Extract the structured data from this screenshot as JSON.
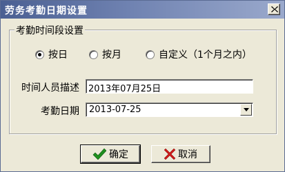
{
  "window": {
    "title": "劳务考勤日期设置"
  },
  "group": {
    "legend": "考勤时间段设置",
    "radios": [
      {
        "label": "按日",
        "checked": true
      },
      {
        "label": "按月",
        "checked": false
      },
      {
        "label": "自定义（1个月之内）",
        "checked": false
      }
    ]
  },
  "fields": {
    "desc_label": "时间人员描述",
    "desc_value": "2013年07月25日",
    "date_label": "考勤日期",
    "date_value": "2013-07-25"
  },
  "buttons": {
    "ok_label": "确定",
    "cancel_label": "取消",
    "ok_icon": "checkmark-icon",
    "cancel_icon": "cross-icon"
  },
  "colors": {
    "title_start": "#4a5f92",
    "title_end": "#9aa9cc",
    "ok_icon": "#1f8f1f",
    "cancel_icon": "#cc1a1a"
  }
}
